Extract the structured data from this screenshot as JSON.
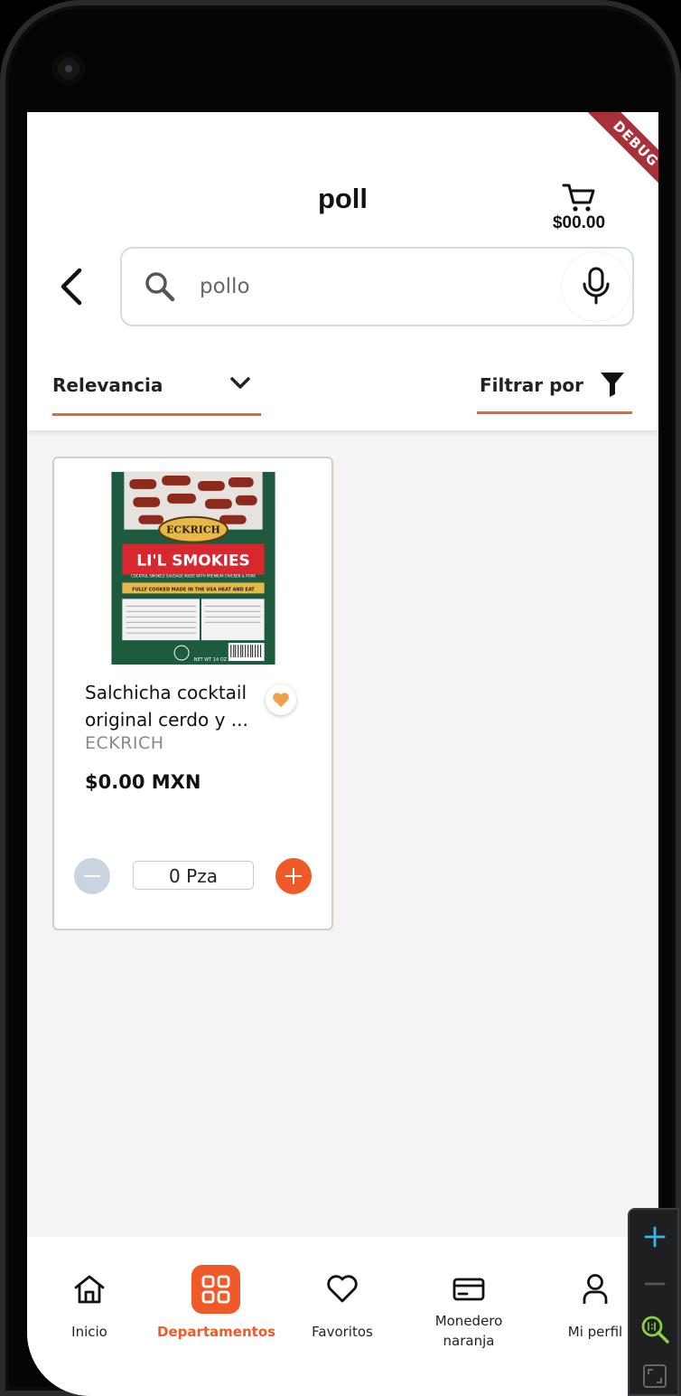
{
  "header": {
    "title": "poll",
    "cart_total": "$00.00",
    "debug_label": "DEBUG"
  },
  "search": {
    "value": "pollo"
  },
  "sort": {
    "label": "Relevancia"
  },
  "filter": {
    "label": "Filtrar por"
  },
  "products": [
    {
      "name_line1": "Salchicha cocktail",
      "name_line2": "original cerdo y ...",
      "brand": "ECKRICH",
      "price": "$0.00 MXN",
      "quantity": "0 Pza",
      "image": {
        "banner": "LI'L SMOKIES",
        "logo": "ECKRICH",
        "subtitle": "COCKTAIL SMOKED SAUSAGE MADE WITH PREMIUM CHICKEN & PORK",
        "strip": "FULLY COOKED  MADE IN THE USA  HEAT AND EAT",
        "net_weight": "NET WT 14 OZ"
      }
    }
  ],
  "bottom_nav": {
    "items": [
      {
        "label": "Inicio",
        "icon": "home-icon"
      },
      {
        "label": "Departamentos",
        "icon": "grid-icon",
        "active": true
      },
      {
        "label": "Favoritos",
        "icon": "heart-icon"
      },
      {
        "label": "Monedero naranja",
        "icon": "card-icon"
      },
      {
        "label": "Mi perfil",
        "icon": "person-icon"
      }
    ]
  },
  "colors": {
    "accent": "#f05a28",
    "underline": "#e8643a",
    "debug_ribbon": "#a8323a",
    "search_border": "#cfdbe6",
    "minus_button": "#c9d4e0",
    "favorite_heart": "#f0a04b"
  }
}
